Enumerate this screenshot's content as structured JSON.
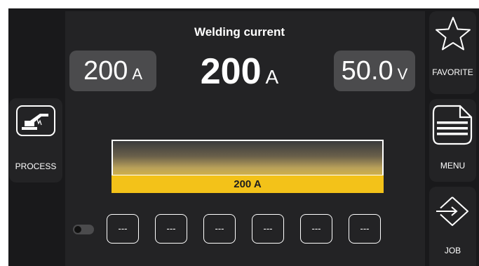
{
  "main": {
    "title": "Welding current",
    "value": "200",
    "unit": "A"
  },
  "left_param": {
    "value": "200",
    "unit": "A"
  },
  "right_param": {
    "value": "50.0",
    "unit": "V"
  },
  "gauge": {
    "label": "200 A",
    "level": 1.0
  },
  "sidebar_left": {
    "process_label": "PROCESS"
  },
  "sidebar_right": {
    "favorite_label": "FAVORITE",
    "menu_label": "MENU",
    "job_label": "JOB"
  },
  "memory_slots": [
    "---",
    "---",
    "---",
    "---",
    "---",
    "---"
  ],
  "icons": {
    "process": "welding-torch-icon",
    "favorite": "star-icon",
    "menu": "menu-document-icon",
    "job": "job-arrows-icon"
  },
  "colors": {
    "accent": "#f3c219",
    "background": "#19191b",
    "panel": "#232325",
    "param_box": "#4b4b4d"
  }
}
